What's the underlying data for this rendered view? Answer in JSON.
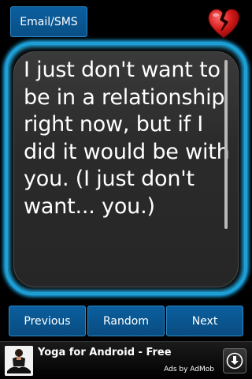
{
  "toolbar": {
    "email_label": "Email/SMS",
    "heart_icon": "broken-heart-icon",
    "heart_color": "#d41a1a"
  },
  "quote": {
    "text": "I just don't want to be in a relationship right now, but if I did it would be with you. (I just don't want... you.)"
  },
  "navigation": {
    "previous_label": "Previous",
    "random_label": "Random",
    "next_label": "Next"
  },
  "ad": {
    "title": "Yoga for Android - Free",
    "attribution": "Ads by AdMob",
    "download_icon": "download-icon"
  },
  "colors": {
    "accent": "#1d9fd6",
    "button": "#0b5f9f",
    "background": "#000000"
  }
}
